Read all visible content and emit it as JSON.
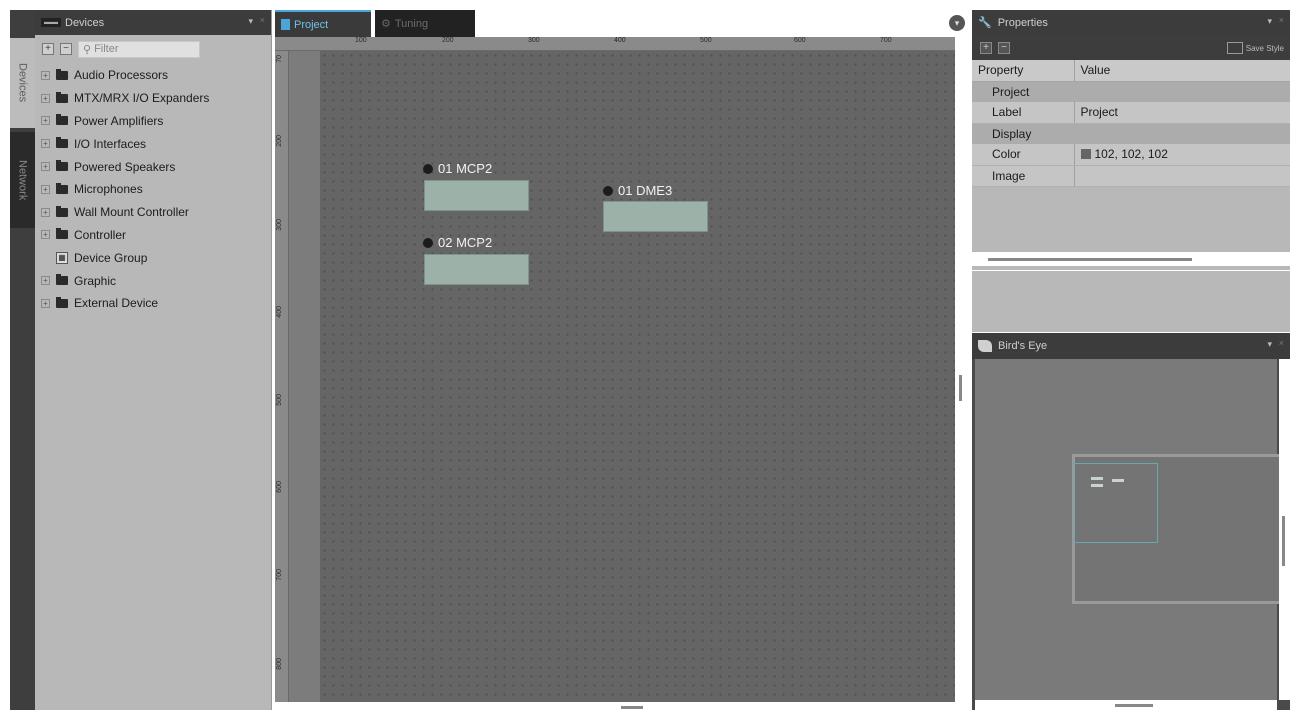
{
  "side_tabs": {
    "devices": "Devices",
    "network": "Network"
  },
  "devices_panel": {
    "title": "Devices",
    "title_badge": "▬▬",
    "filter_placeholder": "Filter",
    "items": [
      {
        "label": "Audio Processors",
        "type": "folder"
      },
      {
        "label": "MTX/MRX I/O Expanders",
        "type": "folder"
      },
      {
        "label": "Power Amplifiers",
        "type": "folder"
      },
      {
        "label": "I/O Interfaces",
        "type": "folder"
      },
      {
        "label": "Powered Speakers",
        "type": "folder"
      },
      {
        "label": "Microphones",
        "type": "folder"
      },
      {
        "label": "Wall Mount Controller",
        "type": "folder"
      },
      {
        "label": "Controller",
        "type": "folder"
      },
      {
        "label": "Device Group",
        "type": "group"
      },
      {
        "label": "Graphic",
        "type": "folder"
      },
      {
        "label": "External Device",
        "type": "folder"
      }
    ]
  },
  "editor": {
    "tabs": [
      {
        "label": "Project",
        "active": true
      },
      {
        "label": "Tuning",
        "active": false
      }
    ],
    "ruler_top": [
      "100",
      "200",
      "300",
      "400",
      "500",
      "600",
      "700"
    ],
    "ruler_left": [
      "70",
      "200",
      "300",
      "400",
      "500",
      "600",
      "700",
      "800"
    ],
    "devices": [
      {
        "name": "01 MCP2"
      },
      {
        "name": "01 DME3"
      },
      {
        "name": "02 MCP2"
      }
    ],
    "canvas_color": "#656565",
    "device_color": "#9cb2a8"
  },
  "properties": {
    "title": "Properties",
    "save_style_label": "Save Style",
    "columns": [
      "Property",
      "Value"
    ],
    "rows": [
      {
        "kind": "category",
        "property": "Project",
        "value": ""
      },
      {
        "kind": "value",
        "property": "Label",
        "value": "Project"
      },
      {
        "kind": "category",
        "property": "Display",
        "value": ""
      },
      {
        "kind": "value",
        "property": "Color",
        "value": "102, 102, 102",
        "swatch": "#666666"
      },
      {
        "kind": "value",
        "property": "Image",
        "value": ""
      }
    ]
  },
  "birds_eye": {
    "title": "Bird's Eye"
  },
  "colors": {
    "accent": "#4aa6d8",
    "panel_dark": "#3c3c3c",
    "panel_light": "#b8b8b8"
  }
}
